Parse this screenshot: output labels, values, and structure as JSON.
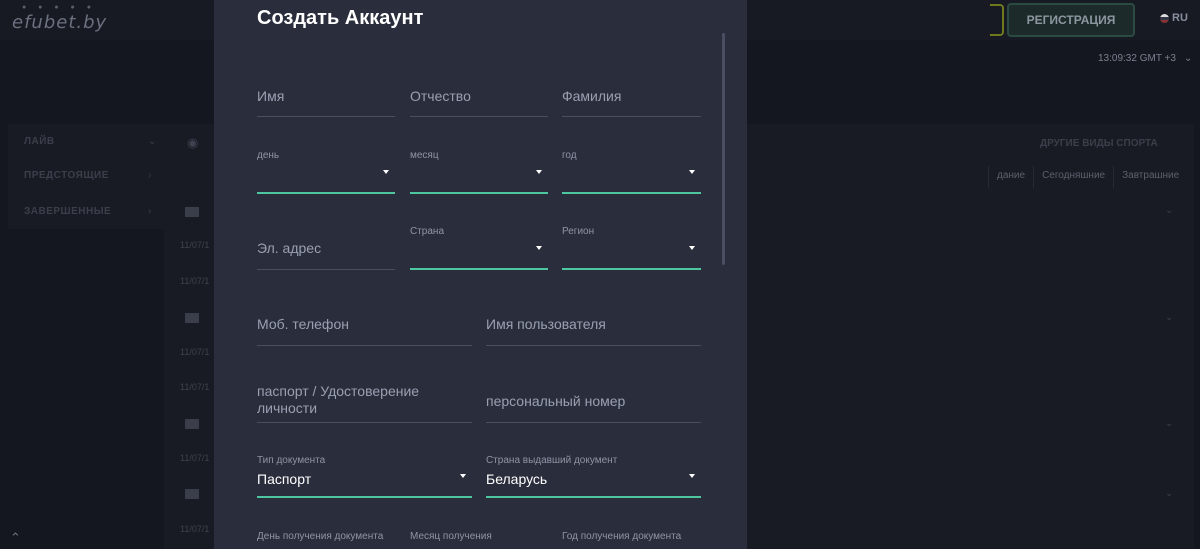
{
  "site": {
    "logo": "efubet.by",
    "logo_dots": "● ● ● ● ●",
    "register_label": "РЕГИСТРАЦИЯ",
    "language": "RU",
    "clock": "13:09:32 GMT +3"
  },
  "sidebar": {
    "items": [
      "ЛАЙВ",
      "ПРЕДСТОЯЩИЕ",
      "ЗАВЕРШЕННЫЕ"
    ]
  },
  "content": {
    "other_sports": "ДРУГИЕ ВИДЫ СПОРТА",
    "tabs": [
      "дание",
      "Сегодняшние",
      "Завтрашние"
    ],
    "row_date": "11/07/1"
  },
  "modal": {
    "title": "Создать Аккаунт",
    "first_name": "Имя",
    "patronymic": "Отчество",
    "last_name": "Фамилия",
    "day_label": "день",
    "month_label": "месяц",
    "year_label": "год",
    "email": "Эл. адрес",
    "country_label": "Страна",
    "region_label": "Регион",
    "phone": "Моб. телефон",
    "username": "Имя пользователя",
    "passport": "паспорт / Удостоверение личности",
    "personal_number": "персональный номер",
    "doc_type_label": "Тип документа",
    "doc_type_value": "Паспорт",
    "issuing_country_label": "Страна выдавший документ",
    "issuing_country_value": "Беларусь",
    "issue_day_label": "День получения документа",
    "issue_month_label": "Месяц получения",
    "issue_year_label": "Год получения документа"
  },
  "colors": {
    "accent": "#4ec6a0",
    "modal_bg": "#2a2d3c",
    "page_bg": "#14171f"
  },
  "icons": {
    "caret": "caret-down-icon",
    "globe": "globe-icon",
    "flag": "flag-ru-icon",
    "scroll_top": "double-chevron-up-icon"
  }
}
